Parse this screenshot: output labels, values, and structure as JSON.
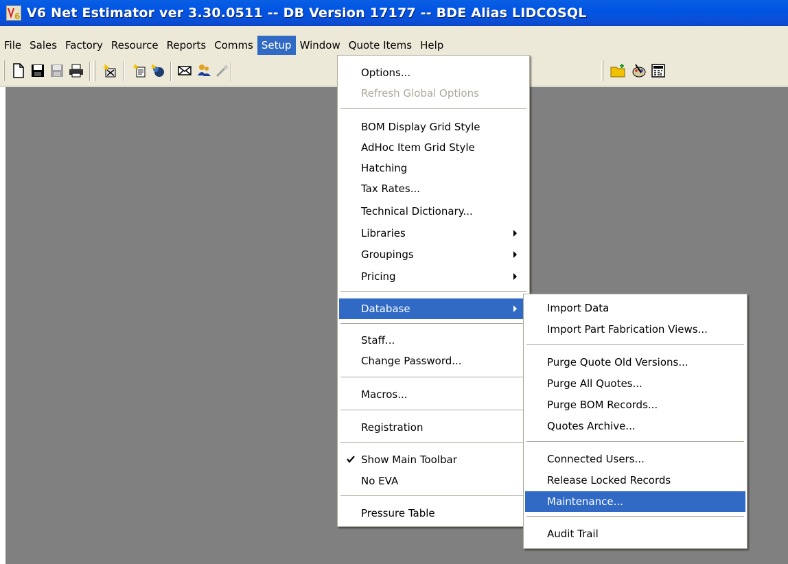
{
  "window": {
    "title": "V6 Net Estimator ver 3.30.0511 -- DB Version 17177 -- BDE Alias LIDCOSQL",
    "app_icon": "v6-app-icon"
  },
  "menubar": {
    "items": [
      {
        "label": "File"
      },
      {
        "label": "Sales"
      },
      {
        "label": "Factory"
      },
      {
        "label": "Resource"
      },
      {
        "label": "Reports"
      },
      {
        "label": "Comms"
      },
      {
        "label": "Setup",
        "active": true
      },
      {
        "label": "Window"
      },
      {
        "label": "Quote Items"
      },
      {
        "label": "Help"
      }
    ]
  },
  "toolbar": {
    "icons": [
      "new-document-icon",
      "save-icon",
      "save-all-icon",
      "print-icon",
      "new-quote-icon",
      "copy-quote-icon",
      "email-icon",
      "users-icon",
      "wand-icon",
      "new-folder-icon",
      "palette-icon",
      "calculator-icon"
    ]
  },
  "setup_menu": {
    "items": [
      {
        "label": "Options..."
      },
      {
        "label": "Refresh Global Options",
        "disabled": true
      },
      {
        "label": "BOM Display Grid Style"
      },
      {
        "label": "AdHoc Item Grid Style"
      },
      {
        "label": "Hatching"
      },
      {
        "label": "Tax Rates..."
      },
      {
        "label": "Technical Dictionary..."
      },
      {
        "label": "Libraries",
        "submenu": true
      },
      {
        "label": "Groupings",
        "submenu": true
      },
      {
        "label": "Pricing",
        "submenu": true
      },
      {
        "label": "Database",
        "submenu": true,
        "highlighted": true
      },
      {
        "label": "Staff..."
      },
      {
        "label": "Change Password..."
      },
      {
        "label": "Macros..."
      },
      {
        "label": "Registration"
      },
      {
        "label": "Show Main Toolbar",
        "checked": true
      },
      {
        "label": "No EVA"
      },
      {
        "label": "Pressure Table"
      }
    ]
  },
  "database_submenu": {
    "items": [
      {
        "label": "Import Data"
      },
      {
        "label": "Import Part Fabrication Views..."
      },
      {
        "label": "Purge Quote Old Versions..."
      },
      {
        "label": "Purge All Quotes..."
      },
      {
        "label": "Purge BOM Records..."
      },
      {
        "label": "Quotes Archive..."
      },
      {
        "label": "Connected Users..."
      },
      {
        "label": "Release Locked Records"
      },
      {
        "label": "Maintenance...",
        "highlighted": true
      },
      {
        "label": "Audit Trail"
      }
    ]
  },
  "colors": {
    "titlebar": "#0054e3",
    "menu_highlight": "#316ac5",
    "chrome": "#ece9d8",
    "mdi_background": "#808080"
  }
}
